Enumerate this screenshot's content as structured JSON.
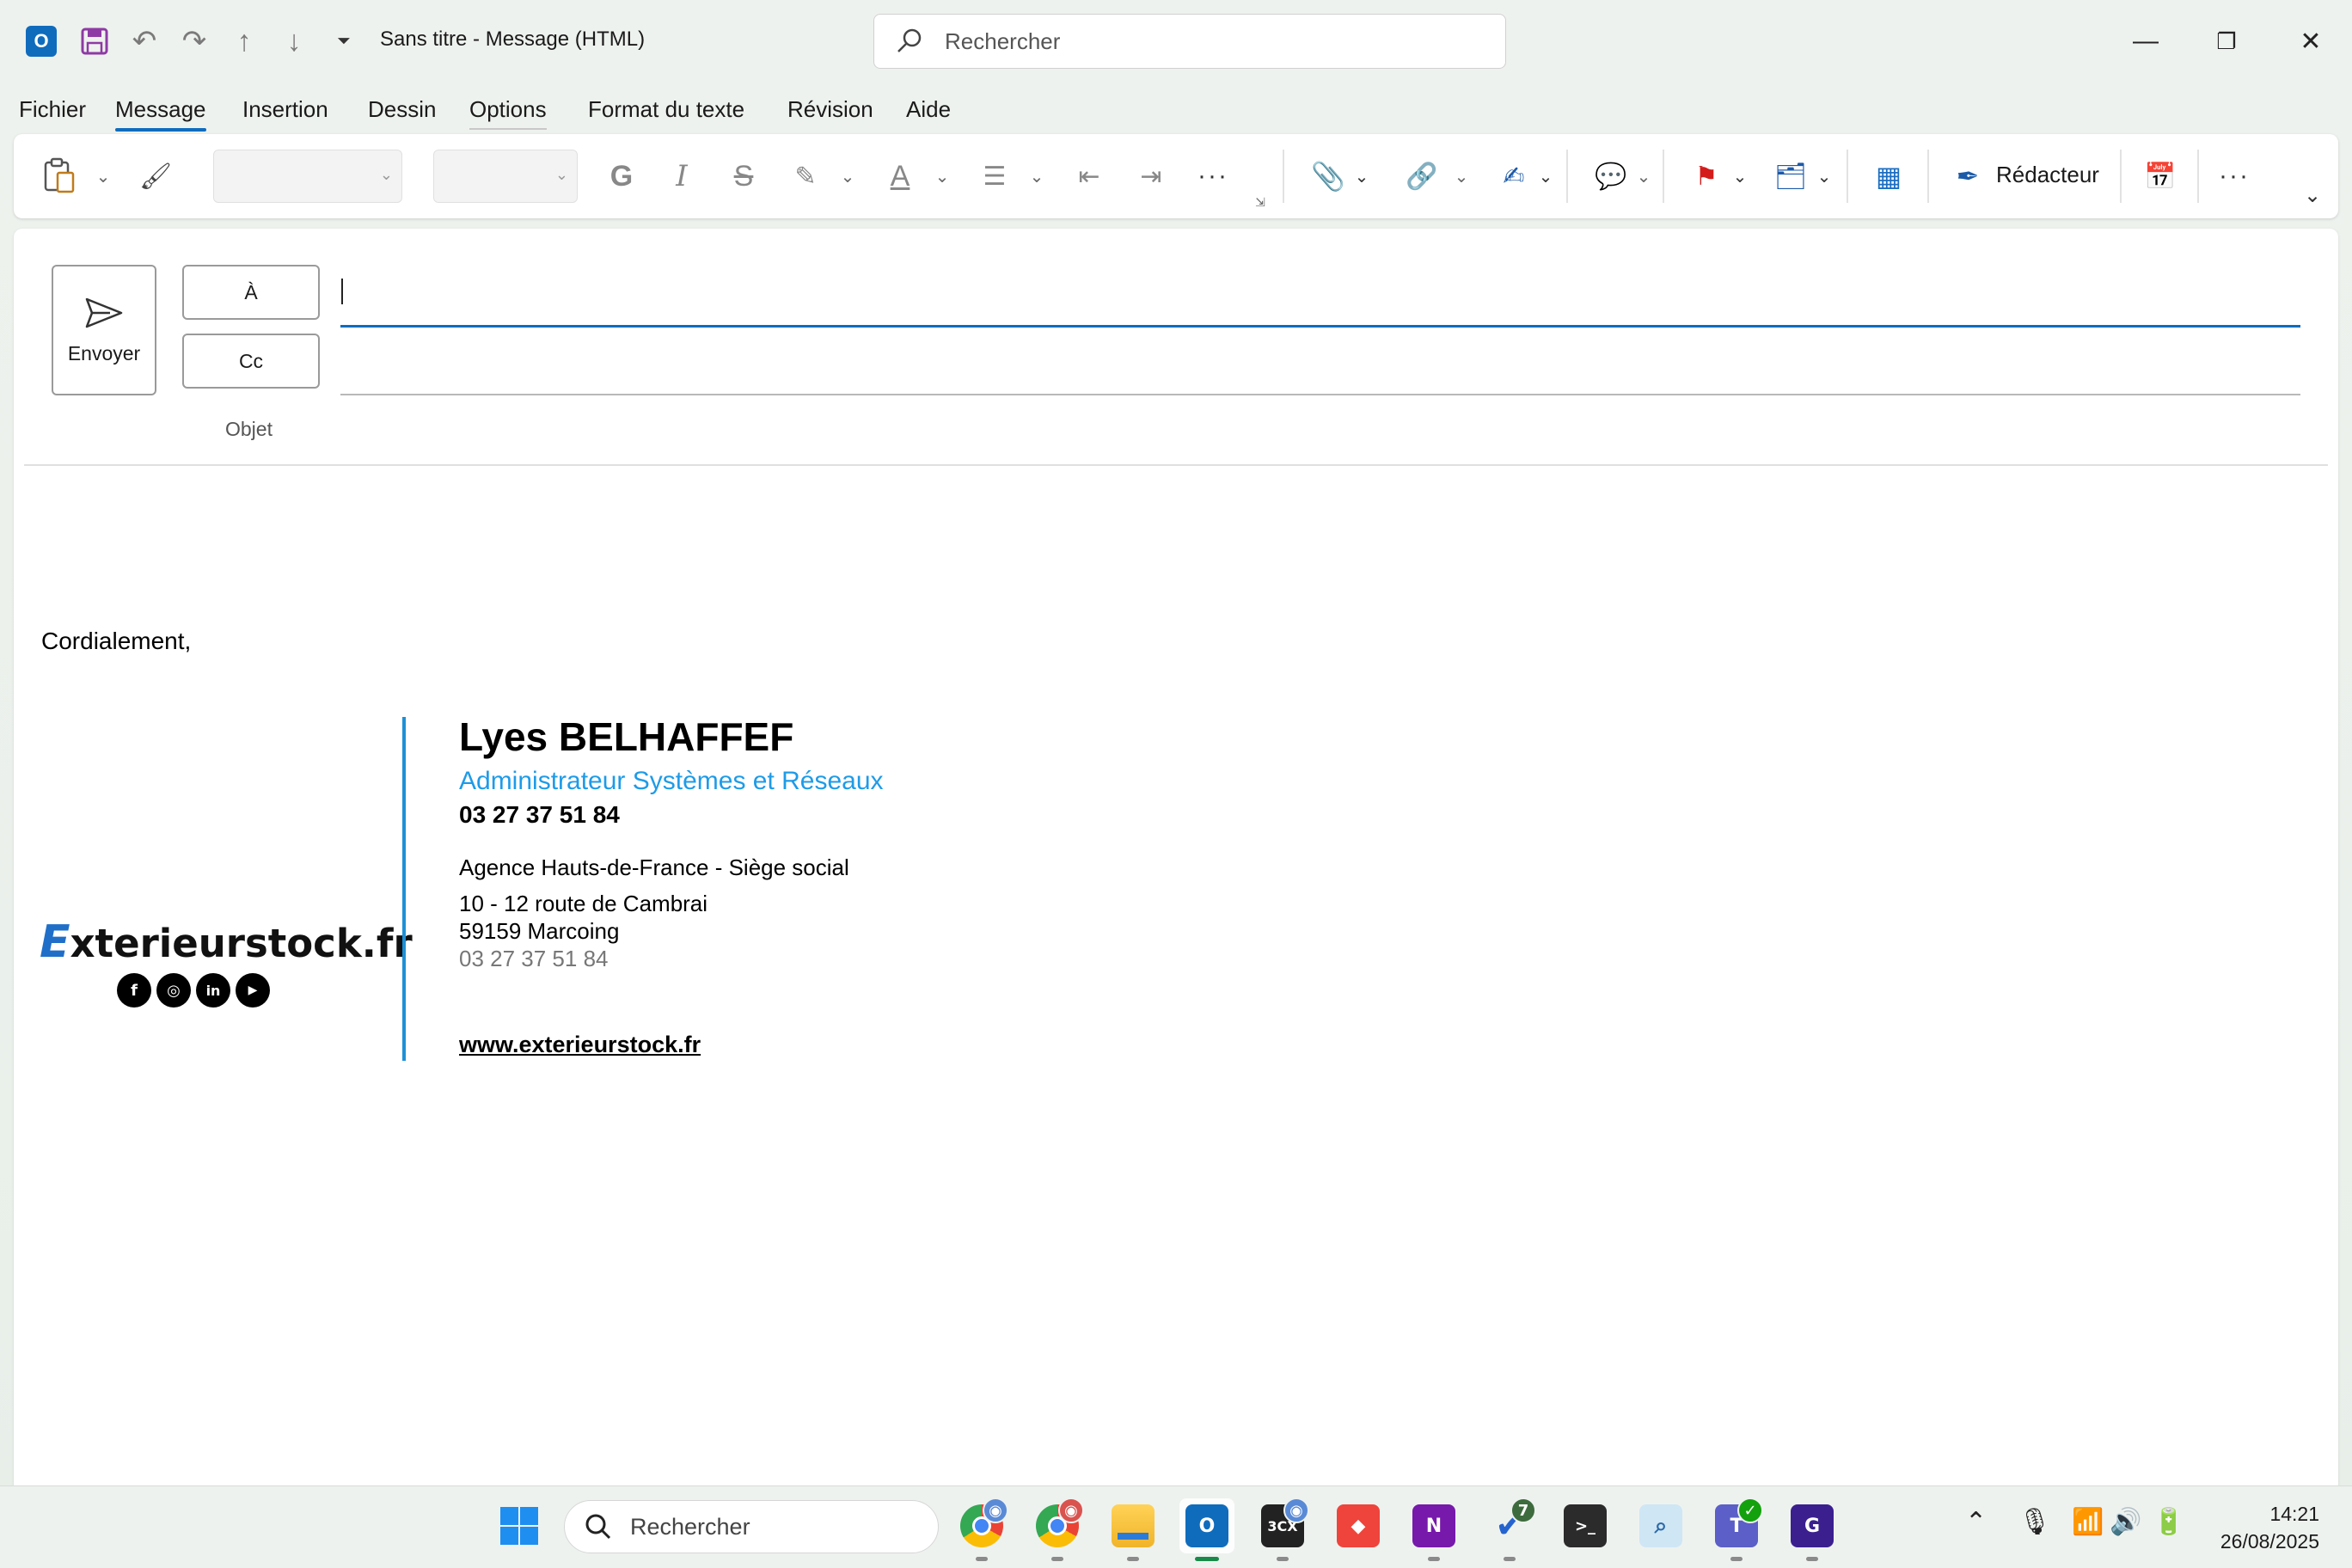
{
  "titlebar": {
    "title": "Sans titre  -  Message (HTML)",
    "search_placeholder": "Rechercher"
  },
  "menu": [
    "Fichier",
    "Message",
    "Insertion",
    "Dessin",
    "Options",
    "Format du texte",
    "Révision",
    "Aide"
  ],
  "ribbon": {
    "bold": "G",
    "italic": "I",
    "strike": "S",
    "font_color_letter": "A",
    "more": "···",
    "redacteur": "Rédacteur"
  },
  "compose": {
    "send_label": "Envoyer",
    "to_label": "À",
    "cc_label": "Cc",
    "subject_label": "Objet"
  },
  "body": {
    "greeting": "Cordialement,"
  },
  "signature": {
    "brand_first": "E",
    "brand_rest": "xterieurstock.fr",
    "socials": [
      "f",
      "◎",
      "in",
      "▶"
    ],
    "name": "Lyes BELHAFFEF",
    "role": "Administrateur Systèmes et Réseaux",
    "phone": "03 27 37 51 84",
    "agency": "Agence Hauts-de-France - Siège social",
    "address1": "10 - 12 route de Cambrai",
    "address2": "59159 Marcoing",
    "phone2": "03 27 37 51 84",
    "website": "www.exterieurstock.fr"
  },
  "taskbar": {
    "search_placeholder": "Rechercher",
    "todo_badge": "7",
    "time": "14:21",
    "date": "26/08/2025"
  },
  "colors": {
    "accent": "#0f6cbd",
    "signature_blue": "#1e9be8",
    "brand_blue": "#1f6fc9"
  }
}
